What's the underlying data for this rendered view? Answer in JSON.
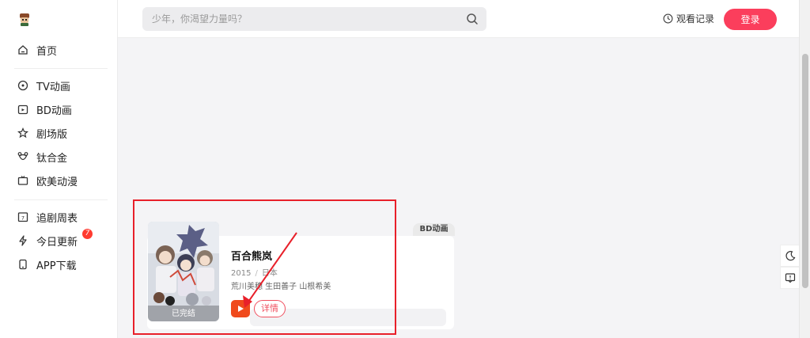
{
  "colors": {
    "accent": "#fb3e5c",
    "play": "#f04a1c",
    "highlight": "#e8202a"
  },
  "sidebar": {
    "logo_icon": "mascot-logo-icon",
    "items": [
      {
        "label": "首页",
        "icon": "home-icon"
      },
      {
        "label": "TV动画",
        "icon": "tv-icon"
      },
      {
        "label": "BD动画",
        "icon": "bd-icon"
      },
      {
        "label": "剧场版",
        "icon": "star-icon"
      },
      {
        "label": "钛合金",
        "icon": "bear-icon"
      },
      {
        "label": "欧美动漫",
        "icon": "screen-icon"
      },
      {
        "label": "追剧周表",
        "icon": "calendar-icon"
      },
      {
        "label": "今日更新",
        "icon": "bolt-icon",
        "badge": "7"
      },
      {
        "label": "APP下载",
        "icon": "phone-icon"
      }
    ]
  },
  "header": {
    "search_placeholder": "少年，你渴望力量吗？",
    "history_label": "观看记录",
    "login_label": "登录"
  },
  "card": {
    "tag": "BD动画",
    "title": "百合熊岚",
    "year": "2015",
    "region": "日本",
    "cast": "荒川美穗 生田善子 山根希美",
    "status": "已完结",
    "details_label": "详情"
  }
}
